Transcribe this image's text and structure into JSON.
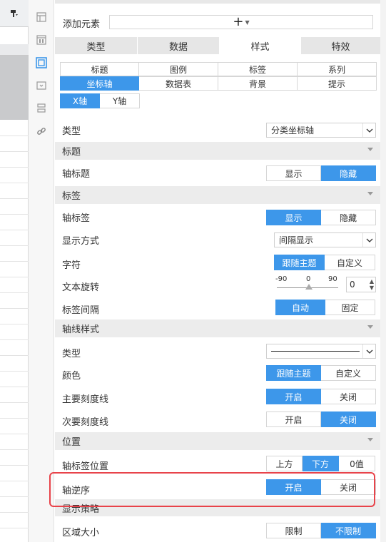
{
  "panel": {
    "add_element_label": "添加元素",
    "add_element_button": "+",
    "tabs": [
      {
        "label": "类型",
        "active": false
      },
      {
        "label": "数据",
        "active": false
      },
      {
        "label": "样式",
        "active": true
      },
      {
        "label": "特效",
        "active": false
      }
    ],
    "style_tabs_row1": [
      "标题",
      "图例",
      "标签",
      "系列"
    ],
    "style_tabs_row2": [
      "坐标轴",
      "数据表",
      "背景",
      "提示"
    ],
    "style_tab_active": "坐标轴",
    "axis_tabs": [
      "X轴",
      "Y轴"
    ],
    "axis_tab_active": "X轴"
  },
  "props": {
    "type_label": "类型",
    "type_value": "分类坐标轴",
    "sections": {
      "title": "标题",
      "labels": "标签",
      "axis_style": "轴线样式",
      "position": "位置",
      "display_strategy": "显示策略"
    },
    "axis_title_label": "轴标题",
    "axis_title_options": [
      "显示",
      "隐藏"
    ],
    "axis_title_active": "隐藏",
    "axis_labels_label": "轴标签",
    "axis_labels_options": [
      "显示",
      "隐藏"
    ],
    "axis_labels_active": "显示",
    "display_mode_label": "显示方式",
    "display_mode_value": "间隔显示",
    "chars_label": "字符",
    "chars_options": [
      "跟随主题",
      "自定义"
    ],
    "chars_active": "跟随主题",
    "rotation_label": "文本旋转",
    "rotation_ticks": [
      "-90",
      "0",
      "90"
    ],
    "rotation_value": "0",
    "label_interval_label": "标签间隔",
    "label_interval_options": [
      "自动",
      "固定"
    ],
    "label_interval_active": "自动",
    "line_type_label": "类型",
    "color_label": "颜色",
    "color_options": [
      "跟随主题",
      "自定义"
    ],
    "color_active": "跟随主题",
    "major_tick_label": "主要刻度线",
    "major_tick_options": [
      "开启",
      "关闭"
    ],
    "major_tick_active": "开启",
    "minor_tick_label": "次要刻度线",
    "minor_tick_options": [
      "开启",
      "关闭"
    ],
    "minor_tick_active": "关闭",
    "label_position_label": "轴标签位置",
    "label_position_options": [
      "上方",
      "下方",
      "0值"
    ],
    "label_position_active": "下方",
    "reverse_label": "轴逆序",
    "reverse_options": [
      "开启",
      "关闭"
    ],
    "reverse_active": "开启",
    "area_size_label": "区域大小",
    "area_size_options": [
      "限制",
      "不限制"
    ],
    "area_size_active": "不限制"
  },
  "colors": {
    "accent": "#3d97ea",
    "highlight_border": "#e8434a"
  }
}
